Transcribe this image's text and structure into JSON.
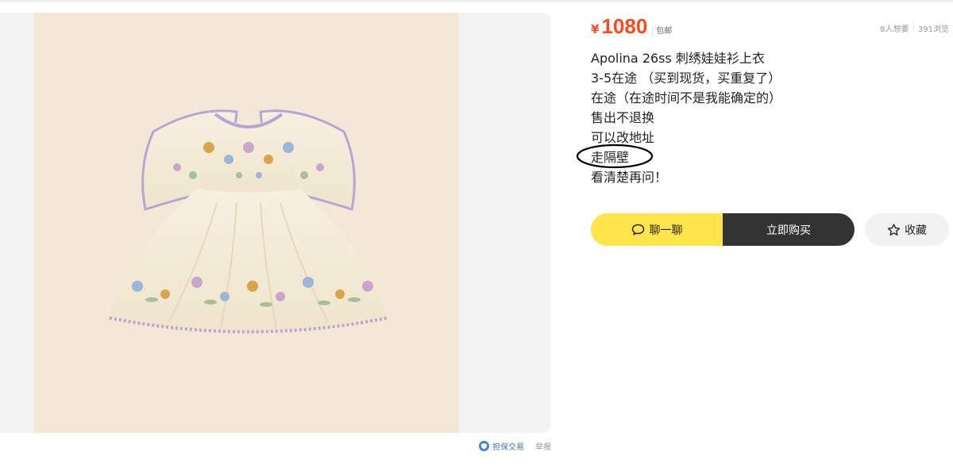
{
  "product": {
    "currency_symbol": "¥",
    "price": "1080",
    "shipping_label": "包邮",
    "wants": "8人想要",
    "views": "391浏览",
    "description_lines": [
      "Apolina 26ss 刺绣娃娃衫上衣",
      "3-5在途 （买到现货，买重复了）",
      "在途（在途时间不是我能确定的）",
      "售出不退换",
      "可以改地址",
      "走隔壁",
      "看清楚再问！"
    ],
    "circled_line_index": 5
  },
  "actions": {
    "chat_label": "聊一聊",
    "buy_label": "立即购买",
    "favorite_label": "收藏"
  },
  "footer": {
    "guarantee_icon_text": "",
    "guarantee_label": "担保交易",
    "report_label": "举报"
  },
  "colors": {
    "price": "#ff4a1f",
    "chat_button": "#ffe54b",
    "buy_button": "#333333",
    "favorite_button": "#f2f2f2",
    "image_background": "#f3e8d6",
    "annotation_circle": "#000000"
  },
  "icons": {
    "chat": "chat-bubble-icon",
    "favorite": "star-outline-icon",
    "guarantee": "guarantee-shield-icon"
  }
}
